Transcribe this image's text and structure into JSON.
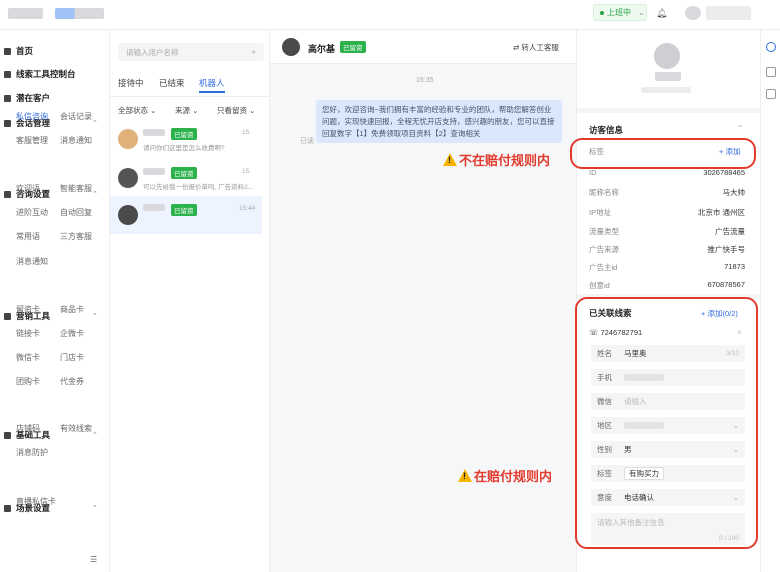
{
  "topbar": {
    "status": "上班中",
    "status_color": "#25a244"
  },
  "sidebar": {
    "sections": [
      {
        "label": "首页"
      },
      {
        "label": "线索工具控制台"
      },
      {
        "label": "潜在客户"
      },
      {
        "label": "会话管理",
        "subs": [
          [
            "私信咨询",
            "会话记录"
          ],
          [
            "客服管理",
            "消息通知"
          ]
        ]
      },
      {
        "label": "咨询设置",
        "subs": [
          [
            "欢迎语",
            "智能客服"
          ],
          [
            "进阶互动",
            "自动回复"
          ],
          [
            "常用语",
            "三方客服"
          ],
          [
            "消息通知",
            ""
          ]
        ]
      },
      {
        "label": "营销工具",
        "subs": [
          [
            "留资卡",
            "商品卡"
          ],
          [
            "链接卡",
            "企微卡"
          ],
          [
            "微信卡",
            "门店卡"
          ],
          [
            "团购卡",
            "代金券"
          ]
        ]
      },
      {
        "label": "基础工具",
        "subs": [
          [
            "店铺码",
            "有效线索"
          ],
          [
            "消息防护",
            ""
          ]
        ]
      },
      {
        "label": "场景设置",
        "subs": [
          [
            "直播私信卡",
            ""
          ]
        ]
      }
    ]
  },
  "conversations": {
    "search_placeholder": "请输入用户名称",
    "tabs": [
      "接待中",
      "已结束",
      "机器人"
    ],
    "filters": [
      "全部状态",
      "来源",
      "只看留资"
    ],
    "items": [
      {
        "badge": "已留资",
        "time": "15:",
        "msg": "请问你们这里是怎么收费啊?"
      },
      {
        "badge": "已留资",
        "time": "15:",
        "msg": "可以先给我一份报价单吗, 广告资料2..."
      },
      {
        "badge": "已留资",
        "time": "15:44",
        "msg": ""
      }
    ]
  },
  "chat": {
    "name": "高尔基",
    "badge": "已留资",
    "transfer": "转人工客服",
    "time": "15:35",
    "bubble": "您好，欢迎咨询~我们拥有丰富的经验和专业的团队，帮助您解答创业问题，实现快速回报，全程无忧开店支持，感兴趣的朋友，您可以直接回复数字【1】免费领取项目资料【2】查询相关",
    "read": "已读"
  },
  "profile": {
    "visitor_title": "访客信息",
    "tag_label": "标签",
    "tag_add": "+ 添加",
    "rows": [
      {
        "label": "ID",
        "value": "3026788465"
      },
      {
        "label": "昵称名称",
        "value": "马大帅"
      },
      {
        "label": "IP地址",
        "value": "北京市 通州区"
      },
      {
        "label": "流量类型",
        "value": "广告流量"
      },
      {
        "label": "广告来源",
        "value": "推广快手号"
      },
      {
        "label": "广告主id",
        "value": "71873"
      },
      {
        "label": "创意id",
        "value": "670878567"
      }
    ],
    "lead_title": "已关联线索",
    "lead_add": "+ 添加(0/2)",
    "phone": "7246782791",
    "fields": [
      {
        "label": "姓名",
        "value": "马里奥",
        "count": "3/10"
      },
      {
        "label": "手机",
        "value": ""
      },
      {
        "label": "微信",
        "value": "",
        "placeholder": "请输入"
      },
      {
        "label": "地区",
        "value": ""
      },
      {
        "label": "性别",
        "value": "男"
      },
      {
        "label": "标签",
        "value": "有购买力"
      },
      {
        "label": "意度",
        "value": "电话确认"
      }
    ],
    "remark_placeholder": "请输入其他备注信息",
    "remark_count": "0 / 100"
  },
  "annotations": {
    "a1": "不在赔付规则内",
    "a2": "在赔付规则内",
    "color": "#e23b2e"
  }
}
